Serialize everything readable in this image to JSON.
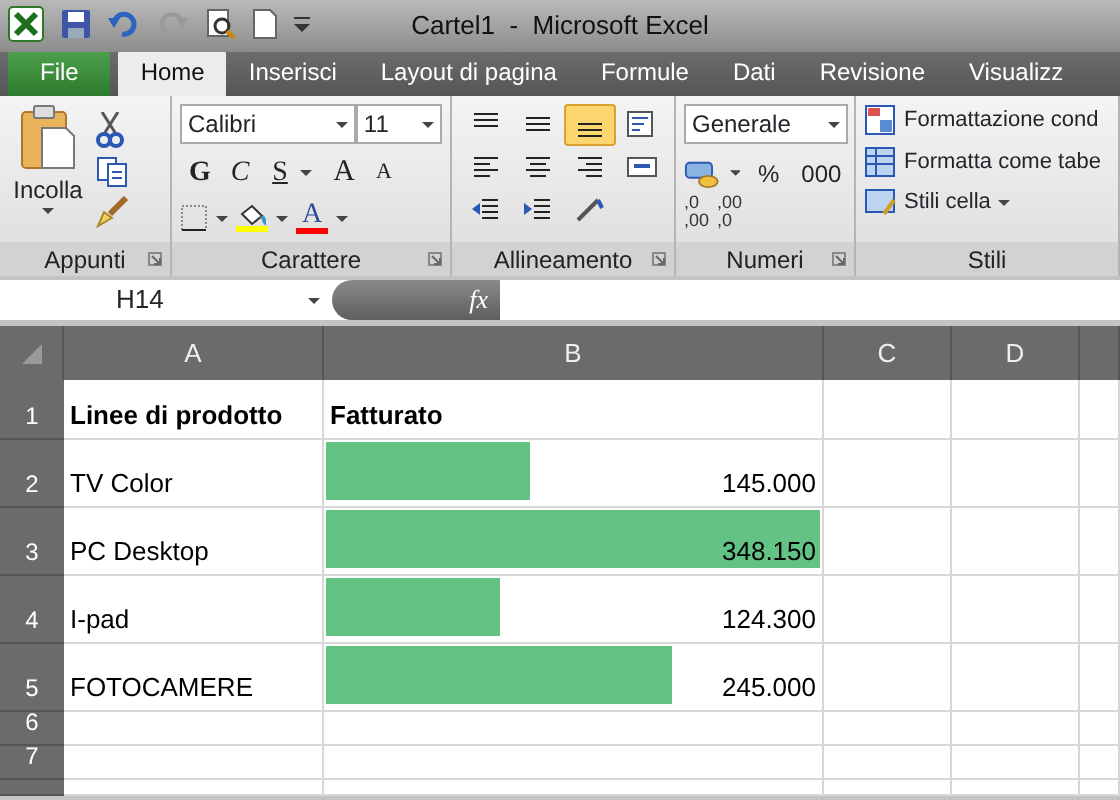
{
  "window": {
    "title": "Cartel1  -  Microsoft Excel"
  },
  "tabs": [
    {
      "label": "File",
      "kind": "file",
      "selected": false
    },
    {
      "label": "Home",
      "kind": "tab",
      "selected": true
    },
    {
      "label": "Inserisci",
      "kind": "tab",
      "selected": false
    },
    {
      "label": "Layout di pagina",
      "kind": "tab",
      "selected": false
    },
    {
      "label": "Formule",
      "kind": "tab",
      "selected": false
    },
    {
      "label": "Dati",
      "kind": "tab",
      "selected": false
    },
    {
      "label": "Revisione",
      "kind": "tab",
      "selected": false
    },
    {
      "label": "Visualizz",
      "kind": "tab",
      "selected": false
    }
  ],
  "ribbon": {
    "groups": [
      {
        "kind": "clipboard",
        "label": "Appunti",
        "paste": "Incolla"
      },
      {
        "kind": "font",
        "label": "Carattere",
        "font_name": "Calibri",
        "font_size": "11",
        "style_buttons": [
          "G",
          "C",
          "S"
        ],
        "size_buttons": [
          "A",
          "A"
        ],
        "font_color_button": "A"
      },
      {
        "kind": "alignment",
        "label": "Allineamento",
        "buttons": [
          {
            "kind": "top",
            "selected": false
          },
          {
            "kind": "middle",
            "selected": false
          },
          {
            "kind": "bottom",
            "selected": true
          },
          {
            "kind": "wrap",
            "selected": false
          },
          {
            "kind": "left",
            "selected": false
          },
          {
            "kind": "center",
            "selected": false
          },
          {
            "kind": "right",
            "selected": false
          },
          {
            "kind": "merge",
            "selected": false
          },
          {
            "kind": "outdent",
            "selected": false
          },
          {
            "kind": "indent",
            "selected": false
          },
          {
            "kind": "orientation",
            "selected": false
          }
        ]
      },
      {
        "kind": "number",
        "label": "Numeri",
        "format": "Generale",
        "percent": "%",
        "thousands": "000",
        "decimals": [
          {
            "top": ",0",
            "bottom": ",00"
          },
          {
            "top": ",00",
            "bottom": ",0"
          }
        ]
      },
      {
        "kind": "styles",
        "label": "Stili",
        "buttons": [
          "Formattazione cond",
          "Formatta come tabe",
          "Stili cella"
        ]
      }
    ]
  },
  "formula_bar": {
    "name_box": "H14",
    "function_label": "fx"
  },
  "sheet": {
    "columns": [
      "A",
      "B",
      "C",
      "D"
    ],
    "header_row": {
      "number": "1",
      "cells": [
        "Linee di prodotto",
        "Fatturato"
      ]
    },
    "rows": [
      {
        "number": "2",
        "product": "TV Color",
        "value": "145.000",
        "level": 0.416
      },
      {
        "number": "3",
        "product": "PC Desktop",
        "value": "348.150",
        "level": 1.0
      },
      {
        "number": "4",
        "product": "I-pad",
        "value": "124.300",
        "level": 0.357
      },
      {
        "number": "5",
        "product": "FOTOCAMERE",
        "value": "245.000",
        "level": 0.704
      }
    ],
    "empty_rows": [
      "6",
      "7"
    ]
  }
}
